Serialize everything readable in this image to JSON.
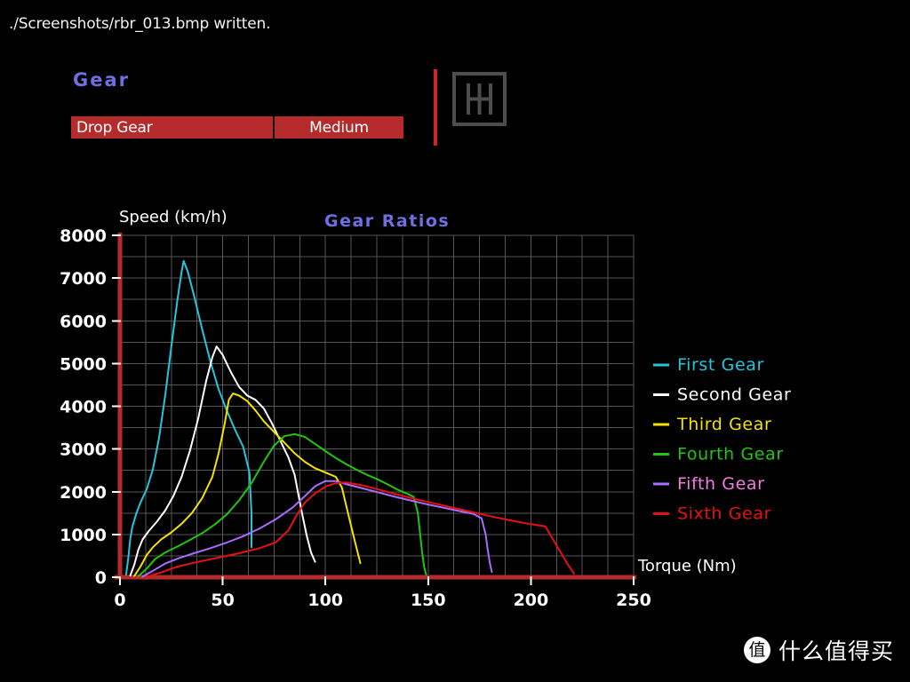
{
  "console": {
    "message": "./Screenshots/rbr_013.bmp written."
  },
  "menu": {
    "heading": "Gear",
    "option": {
      "name": "Drop Gear",
      "value": "Medium"
    },
    "icon": "h-shift-pattern-icon",
    "accent_color": "#b52b2b",
    "rule_color": "#cf2525",
    "heading_color": "#6f6fe2"
  },
  "watermark": {
    "logo_glyph": "值",
    "text": "什么值得买"
  },
  "chart_data": {
    "type": "line",
    "title": "Gear Ratios",
    "xlabel": "Torque (Nm)",
    "ylabel": "Speed (km/h)",
    "xlim": [
      0,
      250
    ],
    "ylim": [
      0,
      8000
    ],
    "xticks": [
      0,
      50,
      100,
      150,
      200,
      250
    ],
    "yticks": [
      0,
      1000,
      2000,
      3000,
      4000,
      5000,
      6000,
      7000,
      8000
    ],
    "grid": true,
    "grid_color": "#565656",
    "axis_color": "#b52b2b",
    "legend_position": "right",
    "series": [
      {
        "name": "First Gear",
        "color": "#21c8dc",
        "label_color": "#21c8dc",
        "points": [
          [
            3,
            60
          ],
          [
            4,
            420
          ],
          [
            5,
            900
          ],
          [
            6,
            1180
          ],
          [
            8,
            1500
          ],
          [
            10,
            1750
          ],
          [
            13,
            2060
          ],
          [
            16,
            2520
          ],
          [
            19,
            3250
          ],
          [
            22,
            4250
          ],
          [
            25,
            5400
          ],
          [
            28,
            6500
          ],
          [
            30,
            7150
          ],
          [
            31,
            7400
          ],
          [
            33,
            7150
          ],
          [
            36,
            6600
          ],
          [
            40,
            5800
          ],
          [
            44,
            5050
          ],
          [
            48,
            4400
          ],
          [
            52,
            3900
          ],
          [
            56,
            3450
          ],
          [
            60,
            3050
          ],
          [
            63,
            2450
          ],
          [
            64,
            1500
          ],
          [
            64,
            700
          ]
        ]
      },
      {
        "name": "Second Gear",
        "color": "#ffffff",
        "label_color": "#ffffff",
        "points": [
          [
            5,
            40
          ],
          [
            7,
            300
          ],
          [
            9,
            650
          ],
          [
            11,
            880
          ],
          [
            14,
            1080
          ],
          [
            18,
            1300
          ],
          [
            22,
            1560
          ],
          [
            26,
            1900
          ],
          [
            30,
            2350
          ],
          [
            34,
            2950
          ],
          [
            38,
            3700
          ],
          [
            42,
            4600
          ],
          [
            45,
            5150
          ],
          [
            47,
            5400
          ],
          [
            50,
            5200
          ],
          [
            54,
            4800
          ],
          [
            58,
            4450
          ],
          [
            62,
            4250
          ],
          [
            66,
            4150
          ],
          [
            70,
            3950
          ],
          [
            74,
            3600
          ],
          [
            78,
            3200
          ],
          [
            82,
            2800
          ],
          [
            85,
            2400
          ],
          [
            87,
            1900
          ],
          [
            89,
            1400
          ],
          [
            91,
            950
          ],
          [
            93,
            580
          ],
          [
            95,
            360
          ]
        ]
      },
      {
        "name": "Third Gear",
        "color": "#f5e200",
        "label_color": "#f5e200",
        "points": [
          [
            7,
            30
          ],
          [
            10,
            250
          ],
          [
            13,
            520
          ],
          [
            16,
            700
          ],
          [
            20,
            880
          ],
          [
            25,
            1050
          ],
          [
            30,
            1250
          ],
          [
            35,
            1500
          ],
          [
            40,
            1850
          ],
          [
            45,
            2350
          ],
          [
            48,
            2900
          ],
          [
            51,
            3600
          ],
          [
            53,
            4150
          ],
          [
            55,
            4300
          ],
          [
            58,
            4250
          ],
          [
            62,
            4120
          ],
          [
            66,
            3900
          ],
          [
            70,
            3650
          ],
          [
            75,
            3400
          ],
          [
            80,
            3150
          ],
          [
            85,
            2900
          ],
          [
            90,
            2700
          ],
          [
            95,
            2550
          ],
          [
            100,
            2450
          ],
          [
            105,
            2350
          ],
          [
            108,
            2100
          ],
          [
            110,
            1700
          ],
          [
            112,
            1300
          ],
          [
            114,
            900
          ],
          [
            116,
            520
          ],
          [
            117,
            330
          ]
        ]
      },
      {
        "name": "Fourth Gear",
        "color": "#1fc80f",
        "label_color": "#1fc80f",
        "points": [
          [
            9,
            25
          ],
          [
            13,
            200
          ],
          [
            17,
            420
          ],
          [
            22,
            580
          ],
          [
            28,
            720
          ],
          [
            34,
            870
          ],
          [
            40,
            1030
          ],
          [
            46,
            1230
          ],
          [
            52,
            1470
          ],
          [
            58,
            1800
          ],
          [
            64,
            2200
          ],
          [
            70,
            2700
          ],
          [
            75,
            3080
          ],
          [
            80,
            3300
          ],
          [
            85,
            3350
          ],
          [
            90,
            3280
          ],
          [
            95,
            3120
          ],
          [
            100,
            2950
          ],
          [
            105,
            2790
          ],
          [
            110,
            2650
          ],
          [
            115,
            2520
          ],
          [
            120,
            2400
          ],
          [
            125,
            2300
          ],
          [
            130,
            2180
          ],
          [
            135,
            2050
          ],
          [
            140,
            1950
          ],
          [
            143,
            1880
          ],
          [
            145,
            1500
          ],
          [
            146,
            1050
          ],
          [
            147,
            600
          ],
          [
            148,
            250
          ],
          [
            149,
            60
          ]
        ]
      },
      {
        "name": "Fifth Gear",
        "color": "#aa6cff",
        "label_color": "#f27ce0",
        "points": [
          [
            11,
            15
          ],
          [
            16,
            150
          ],
          [
            22,
            320
          ],
          [
            29,
            450
          ],
          [
            36,
            560
          ],
          [
            44,
            680
          ],
          [
            52,
            810
          ],
          [
            60,
            960
          ],
          [
            68,
            1140
          ],
          [
            76,
            1360
          ],
          [
            84,
            1630
          ],
          [
            90,
            1900
          ],
          [
            95,
            2130
          ],
          [
            100,
            2250
          ],
          [
            105,
            2250
          ],
          [
            110,
            2180
          ],
          [
            118,
            2080
          ],
          [
            126,
            1980
          ],
          [
            134,
            1880
          ],
          [
            142,
            1790
          ],
          [
            150,
            1700
          ],
          [
            158,
            1620
          ],
          [
            166,
            1540
          ],
          [
            172,
            1480
          ],
          [
            176,
            1380
          ],
          [
            178,
            1000
          ],
          [
            179,
            650
          ],
          [
            180,
            330
          ],
          [
            181,
            120
          ]
        ]
      },
      {
        "name": "Sixth Gear",
        "color": "#e81010",
        "label_color": "#e81010",
        "points": [
          [
            13,
            10
          ],
          [
            20,
            110
          ],
          [
            28,
            250
          ],
          [
            38,
            360
          ],
          [
            48,
            460
          ],
          [
            58,
            560
          ],
          [
            68,
            680
          ],
          [
            76,
            820
          ],
          [
            82,
            1100
          ],
          [
            86,
            1450
          ],
          [
            90,
            1750
          ],
          [
            95,
            1960
          ],
          [
            100,
            2120
          ],
          [
            105,
            2200
          ],
          [
            110,
            2220
          ],
          [
            118,
            2150
          ],
          [
            126,
            2050
          ],
          [
            134,
            1950
          ],
          [
            142,
            1850
          ],
          [
            150,
            1760
          ],
          [
            160,
            1650
          ],
          [
            170,
            1540
          ],
          [
            180,
            1430
          ],
          [
            190,
            1330
          ],
          [
            200,
            1240
          ],
          [
            207,
            1190
          ],
          [
            210,
            950
          ],
          [
            214,
            620
          ],
          [
            218,
            300
          ],
          [
            221,
            80
          ]
        ]
      }
    ]
  }
}
